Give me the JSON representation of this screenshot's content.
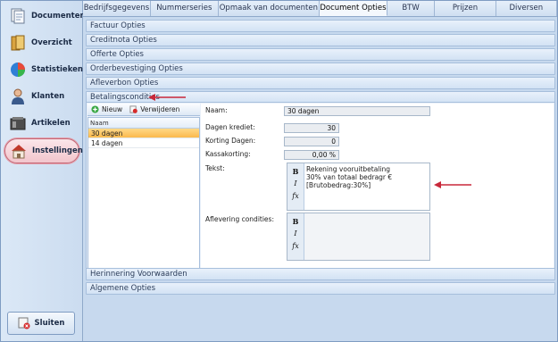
{
  "sidebar": {
    "items": [
      {
        "label": "Documenten",
        "icon": "documents-icon"
      },
      {
        "label": "Overzicht",
        "icon": "book-icon"
      },
      {
        "label": "Statistieken",
        "icon": "pie-chart-icon"
      },
      {
        "label": "Klanten",
        "icon": "person-icon"
      },
      {
        "label": "Artikelen",
        "icon": "box-icon"
      },
      {
        "label": "Instellingen",
        "icon": "house-icon"
      }
    ],
    "close_label": "Sluiten"
  },
  "tabs": [
    "Bedrijfsgegevens",
    "Nummerseries",
    "Opmaak van documenten",
    "Document Opties",
    "BTW",
    "Prijzen",
    "Diversen"
  ],
  "active_tab": "Document Opties",
  "sections_top": [
    "Factuur Opties",
    "Creditnota Opties",
    "Offerte Opties",
    "Orderbevestiging Opties",
    "Afleverbon Opties",
    "Betalingscondities"
  ],
  "sections_bottom": [
    "Herinnering Voorwaarden",
    "Algemene Opties"
  ],
  "list": {
    "new_label": "Nieuw",
    "delete_label": "Verwijderen",
    "header": "Naam",
    "rows": [
      "30 dagen",
      "14 dagen"
    ],
    "selected": "30 dagen"
  },
  "form": {
    "naam_label": "Naam:",
    "naam_value": "30 dagen",
    "dagen_krediet_label": "Dagen krediet:",
    "dagen_krediet_value": "30",
    "korting_dagen_label": "Korting Dagen:",
    "korting_dagen_value": "0",
    "kassakorting_label": "Kassakorting:",
    "kassakorting_value": "0,00 %",
    "tekst_label": "Tekst:",
    "tekst_value": "Rekening vooruitbetaling\n30% van totaal bedragr € [Brutobedrag:30%]",
    "aflevering_label": "Aflevering condities:",
    "aflevering_value": "",
    "rte_bold": "B",
    "rte_italic": "I",
    "rte_fx": "fx"
  },
  "colors": {
    "accent_arrow": "#c8283a",
    "selected_row": "#fbb94c",
    "panel_bg": "#c7d9ee"
  }
}
